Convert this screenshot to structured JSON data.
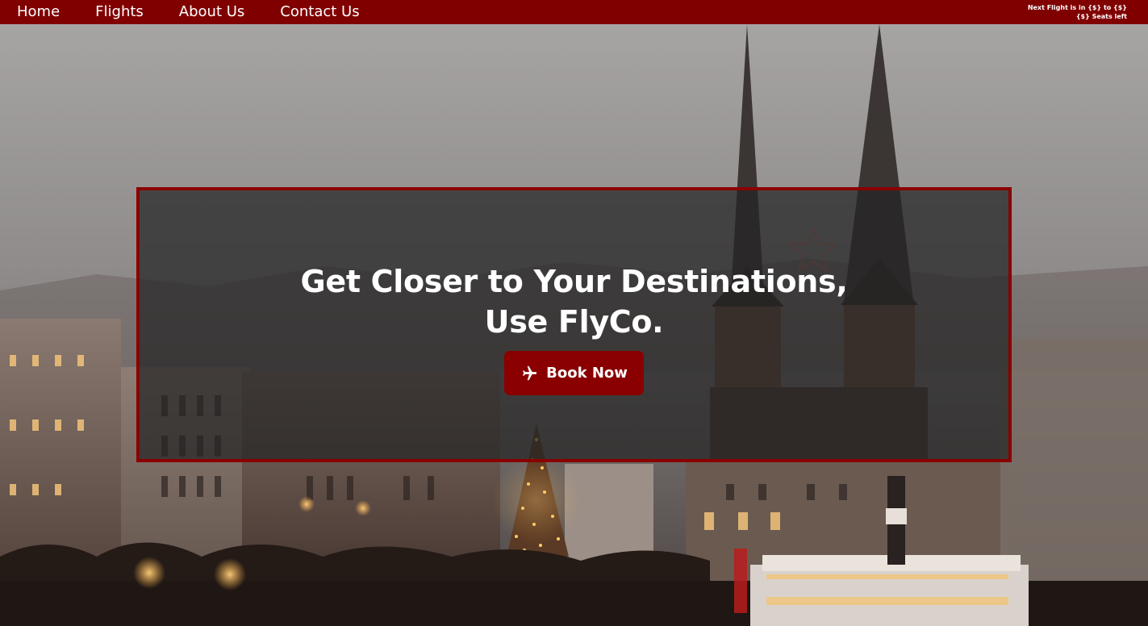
{
  "nav": {
    "items": [
      {
        "label": "Home"
      },
      {
        "label": "Flights"
      },
      {
        "label": "About Us"
      },
      {
        "label": "Contact Us"
      }
    ],
    "next_flight_line1": "Next Flight is in {$} to {$}",
    "next_flight_line2": "{$} Seats left"
  },
  "hero": {
    "title_line1": "Get Closer to Your Destinations,",
    "title_line2": "Use FlyCo.",
    "button_label": "Book Now",
    "button_icon": "airplane-icon"
  },
  "colors": {
    "brand": "#800000",
    "hero_overlay": "#242424",
    "text": "#ffffff"
  }
}
